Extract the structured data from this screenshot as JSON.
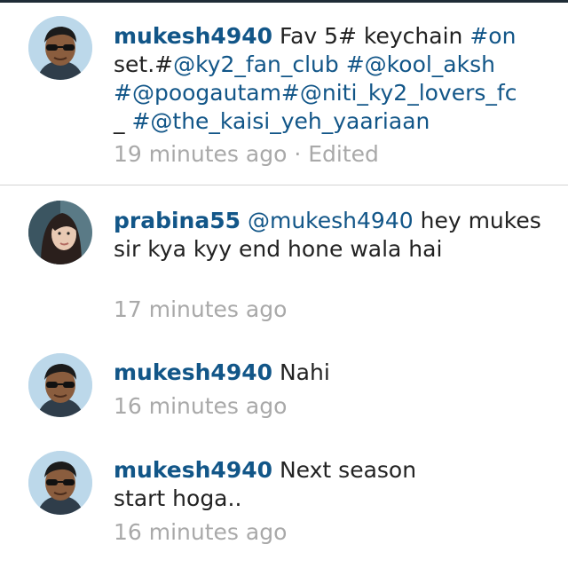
{
  "comments": [
    {
      "username": "mukesh4940",
      "avatar": "man-with-sunglasses-avatar",
      "segments": [
        {
          "type": "text",
          "value": " Fav 5# keychain "
        },
        {
          "type": "tag",
          "value": "#on"
        },
        {
          "type": "text",
          "value": "set.#"
        },
        {
          "type": "tag",
          "value": "@ky2_fan_club"
        },
        {
          "type": "text",
          "value": " "
        },
        {
          "type": "tag",
          "value": "#@kool_aksh"
        },
        {
          "type": "text",
          "value": " "
        },
        {
          "type": "tag",
          "value": "#@poogautam#@niti_ky2_lovers_fc"
        },
        {
          "type": "text",
          "value": " _ "
        },
        {
          "type": "tag",
          "value": "#@the_kaisi_yeh_yaariaan"
        }
      ],
      "time": "19 minutes ago",
      "separator": " · ",
      "edited": "Edited"
    },
    {
      "username": "prabina55",
      "avatar": "woman-portrait-avatar",
      "mention": "@mukesh4940",
      "body": " hey mukes sir kya kyy end hone wala hai",
      "time": "17 minutes ago"
    },
    {
      "username": "mukesh4940",
      "avatar": "man-with-sunglasses-avatar",
      "body": " Nahi",
      "time": "16 minutes ago"
    },
    {
      "username": "mukesh4940",
      "avatar": "man-with-sunglasses-avatar",
      "body": " Next season start hoga..",
      "time": "16 minutes ago"
    }
  ],
  "colors": {
    "username": "#125688",
    "hashtag": "#125688",
    "body": "#222222",
    "timestamp": "#a9a9a9",
    "divider": "#d3d3d3"
  }
}
